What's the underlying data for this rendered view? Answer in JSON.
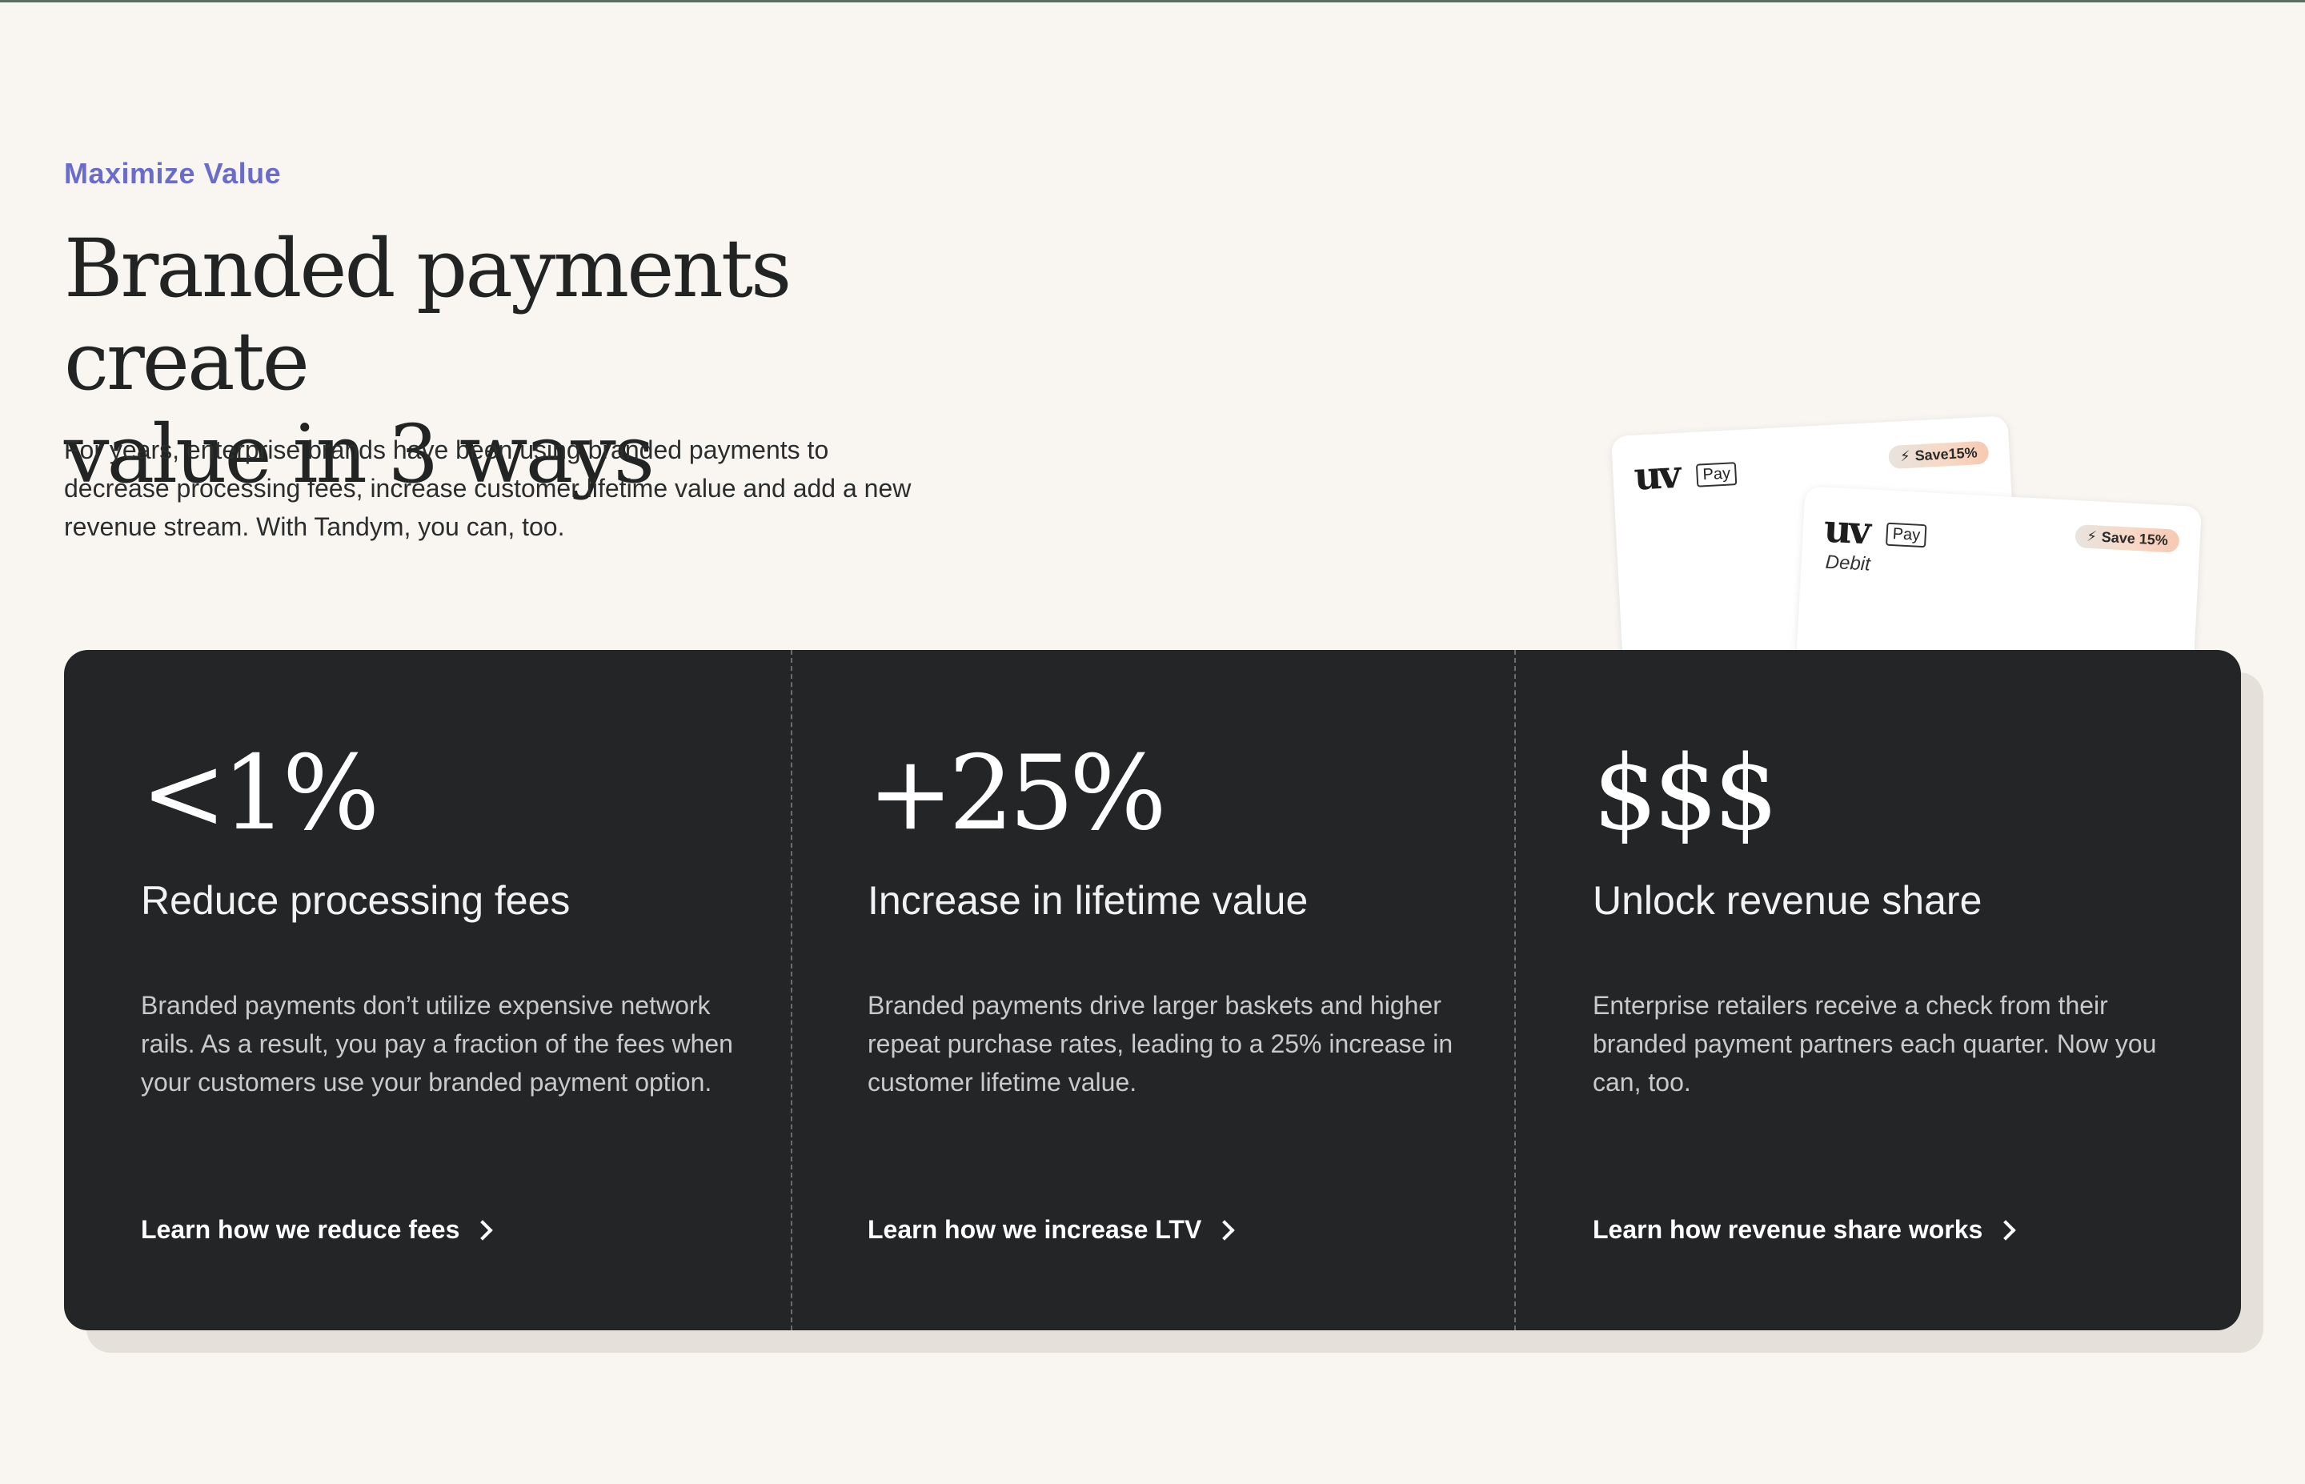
{
  "eyebrow": "Maximize Value",
  "headline": {
    "line1": "Branded payments create",
    "line2": "value in 3 ways"
  },
  "intro": "For years, enterprise brands have been using branded payments to decrease processing fees, increase customer lifetime value and add a new revenue stream. With Tandym, you can, too.",
  "cards": [
    {
      "logo": "uv",
      "tag": "Pay",
      "sub": "",
      "badge": "Save15%"
    },
    {
      "logo": "uv",
      "tag": "Pay",
      "sub": "Debit",
      "badge": "Save 15%"
    }
  ],
  "features": [
    {
      "stat": "<1%",
      "title": "Reduce processing fees",
      "description": "Branded payments don’t utilize expensive network rails. As a result, you pay a fraction of the fees when your customers use your branded payment option.",
      "link": "Learn how we reduce fees"
    },
    {
      "stat": "+25%",
      "title": "Increase in lifetime value",
      "description": "Branded payments drive larger baskets and higher repeat purchase rates, leading to a 25% increase in customer lifetime value.",
      "link": "Learn how we increase LTV"
    },
    {
      "stat": "$$$",
      "title": "Unlock revenue share",
      "description": "Enterprise retailers receive a check from their branded payment partners each quarter. Now you can, too.",
      "link": "Learn how revenue share works"
    }
  ],
  "colors": {
    "background": "#f9f6f2",
    "accent": "#6a6ccc",
    "panel": "#232526"
  }
}
